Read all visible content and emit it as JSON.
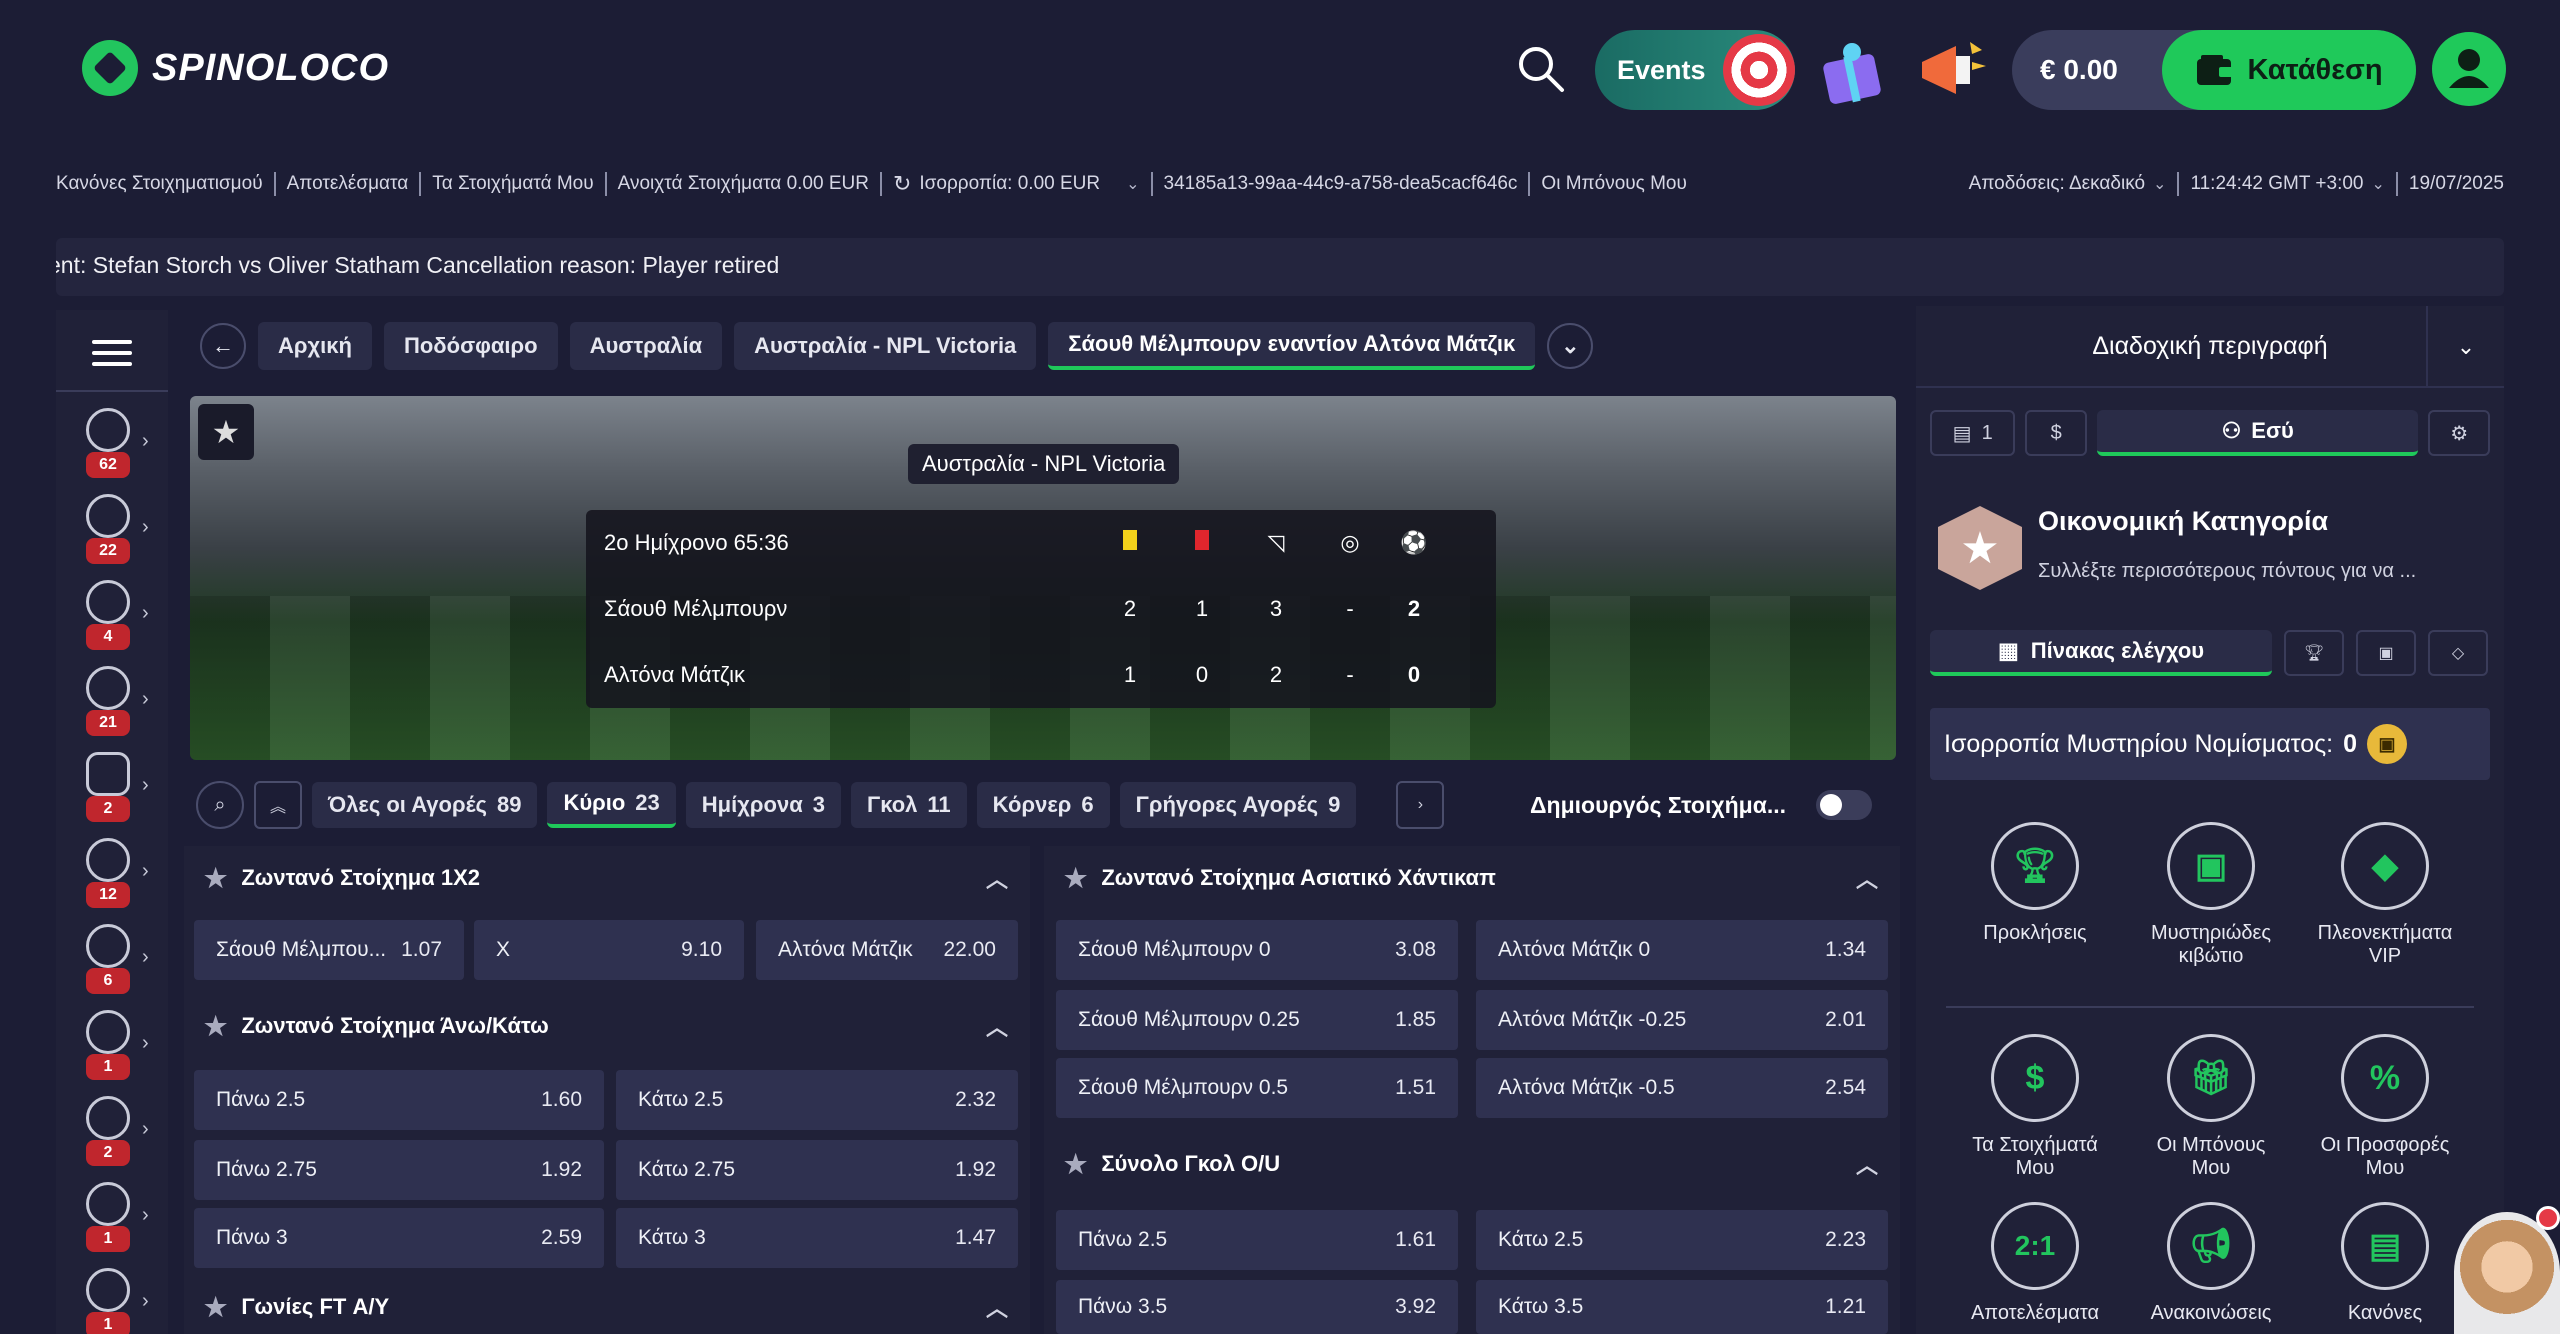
{
  "brand": {
    "name": "SPINOLOCO"
  },
  "header": {
    "events_label": "Events",
    "balance": "€ 0.00",
    "deposit_label": "Κατάθεση"
  },
  "info_bar": {
    "links": [
      "Κανόνες Στοιχηματισμού",
      "Αποτελέσματα",
      "Τα Στοιχήματά Μου",
      "Ανοιχτά Στοιχήματα 0.00 EUR"
    ],
    "balance_label": "Ισορροπία: 0.00 EUR",
    "session_id": "34185a13-99aa-44c9-a758-dea5cacf646c",
    "bonuses": "Οι Μπόνους Μου",
    "odds_label": "Αποδόσεις: Δεκαδικό",
    "time": "11:24:42 GMT +3:00",
    "date": "19/07/2025"
  },
  "ticker": {
    "text": "ent: Stefan Storch vs Oliver Statham Cancellation reason: Player retired"
  },
  "sidebar": {
    "sports": [
      {
        "icon": "football-icon",
        "count": "62"
      },
      {
        "icon": "basketball-icon",
        "count": "22"
      },
      {
        "icon": "volleyball-icon",
        "count": "4"
      },
      {
        "icon": "tennis-icon",
        "count": "21"
      },
      {
        "icon": "esports-icon",
        "count": "2"
      },
      {
        "icon": "hockey-icon",
        "count": "12"
      },
      {
        "icon": "handball-icon",
        "count": "6"
      },
      {
        "icon": "rugby-icon",
        "count": "1"
      },
      {
        "icon": "table-tennis-icon",
        "count": "2"
      },
      {
        "icon": "cycling-icon",
        "count": "1"
      },
      {
        "icon": "badminton-icon",
        "count": "1"
      }
    ]
  },
  "breadcrumbs": [
    "Αρχική",
    "Ποδόσφαιρο",
    "Αυστραλία",
    "Αυστραλία - NPL Victoria",
    "Σάουθ Μέλμπουρν εναντίον Αλτόνα Μάτζικ"
  ],
  "match": {
    "league": "Αυστραλία - NPL Victoria",
    "period": "2ο Ημίχρονο 65:36",
    "home": {
      "name": "Σάουθ Μέλμπουρν",
      "yellow": "2",
      "red": "1",
      "corners": "3",
      "pen": "-",
      "goals": "2"
    },
    "away": {
      "name": "Αλτόνα Μάτζικ",
      "yellow": "1",
      "red": "0",
      "corners": "2",
      "pen": "-",
      "goals": "0"
    }
  },
  "market_tabs": [
    {
      "label": "Όλες οι Αγορές",
      "count": "89"
    },
    {
      "label": "Κύριο",
      "count": "23"
    },
    {
      "label": "Ημίχρονα",
      "count": "3"
    },
    {
      "label": "Γκολ",
      "count": "11"
    },
    {
      "label": "Κόρνερ",
      "count": "6"
    },
    {
      "label": "Γρήγορες Αγορές",
      "count": "9"
    }
  ],
  "bet_builder": "Δημιουργός Στοιχήμα...",
  "markets": {
    "m1x2": {
      "title": "Ζωντανό Στοίχημα 1X2",
      "odds": [
        {
          "label": "Σάουθ Μέλμπου...",
          "value": "1.07"
        },
        {
          "label": "X",
          "value": "9.10"
        },
        {
          "label": "Αλτόνα Μάτζικ",
          "value": "22.00"
        }
      ]
    },
    "ou": {
      "title": "Ζωντανό Στοίχημα Άνω/Κάτω",
      "odds": [
        {
          "label": "Πάνω 2.5",
          "value": "1.60"
        },
        {
          "label": "Κάτω 2.5",
          "value": "2.32"
        },
        {
          "label": "Πάνω 2.75",
          "value": "1.92"
        },
        {
          "label": "Κάτω 2.75",
          "value": "1.92"
        },
        {
          "label": "Πάνω 3",
          "value": "2.59"
        },
        {
          "label": "Κάτω 3",
          "value": "1.47"
        }
      ]
    },
    "corners": {
      "title": "Γωνίες FT Α/Υ"
    },
    "asian": {
      "title": "Ζωντανό Στοίχημα Ασιατικό Χάντικαπ",
      "odds": [
        {
          "label": "Σάουθ Μέλμπουρν 0",
          "value": "3.08"
        },
        {
          "label": "Αλτόνα Μάτζικ 0",
          "value": "1.34"
        },
        {
          "label": "Σάουθ Μέλμπουρν 0.25",
          "value": "1.85"
        },
        {
          "label": "Αλτόνα Μάτζικ -0.25",
          "value": "2.01"
        },
        {
          "label": "Σάουθ Μέλμπουρν 0.5",
          "value": "1.51"
        },
        {
          "label": "Αλτόνα Μάτζικ -0.5",
          "value": "2.54"
        }
      ]
    },
    "goals": {
      "title": "Σύνολο Γκολ O/U",
      "odds": [
        {
          "label": "Πάνω 2.5",
          "value": "1.61"
        },
        {
          "label": "Κάτω 2.5",
          "value": "2.23"
        },
        {
          "label": "Πάνω 3.5",
          "value": "3.92"
        },
        {
          "label": "Κάτω 3.5",
          "value": "1.21"
        }
      ]
    }
  },
  "right_panel": {
    "header": "Διαδοχική περιγραφή",
    "betslip_count": "1",
    "you_tab": "Εσύ",
    "category_title": "Οικονομική Κατηγορία",
    "category_sub": "Συλλέξτε περισσότερους πόντους για να ...",
    "dashboard_tab": "Πίνακας ελέγχου",
    "mystery_label": "Ισορροπία Μυστηρίου Νομίσματος:",
    "mystery_value": "0",
    "grid": [
      {
        "label": "Προκλήσεις",
        "icon": "trophy-icon"
      },
      {
        "label": "Μυστηριώδες κιβώτιο",
        "icon": "mystery-box-icon"
      },
      {
        "label": "Πλεονεκτήματα VIP",
        "icon": "diamond-icon"
      },
      {
        "label": "Τα Στοιχήματά Μου",
        "icon": "bets-icon"
      },
      {
        "label": "Οι Μπόνους Μου",
        "icon": "gift-icon"
      },
      {
        "label": "Οι Προσφορές Μου",
        "icon": "offers-icon"
      },
      {
        "label": "Αποτελέσματα",
        "icon": "results-icon"
      },
      {
        "label": "Ανακοινώσεις",
        "icon": "megaphone-icon"
      },
      {
        "label": "Κανόνες",
        "icon": "rules-icon"
      }
    ]
  }
}
